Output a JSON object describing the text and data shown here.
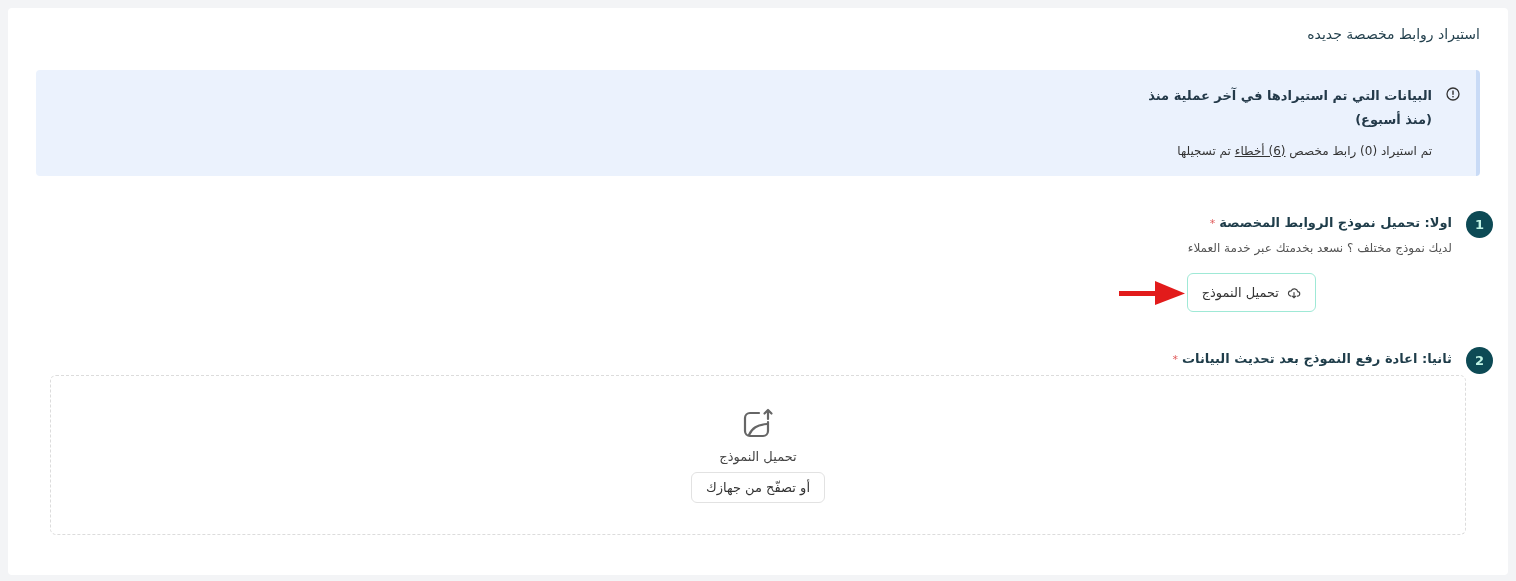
{
  "title": "استيراد روابط مخصصة جديده",
  "info": {
    "heading": "البيانات التي تم استيرادها في آخر عملية منذ",
    "subheading": "(منذ أسبوع)",
    "summary_before": "تم استيراد (0) رابط مخصص",
    "summary_link": "(6) أخطاء",
    "summary_after": "تم تسجيلها"
  },
  "steps": [
    {
      "number": "1",
      "title": "اولا: تحميل نموذج الروابط المخصصة",
      "required_mark": "*",
      "kind": "download",
      "hint": "لديك نموذج مختلف ؟ نسعد بخدمتك عبر خدمة العملاء",
      "button": "تحميل النموذج"
    },
    {
      "number": "2",
      "title": "ثانيا: اعادة رفع النموذج بعد تحديث البيانات",
      "required_mark": "*",
      "kind": "upload",
      "drop_label": "تحميل النموذج",
      "browse_button": "أو تصفّح من جهازك"
    }
  ]
}
